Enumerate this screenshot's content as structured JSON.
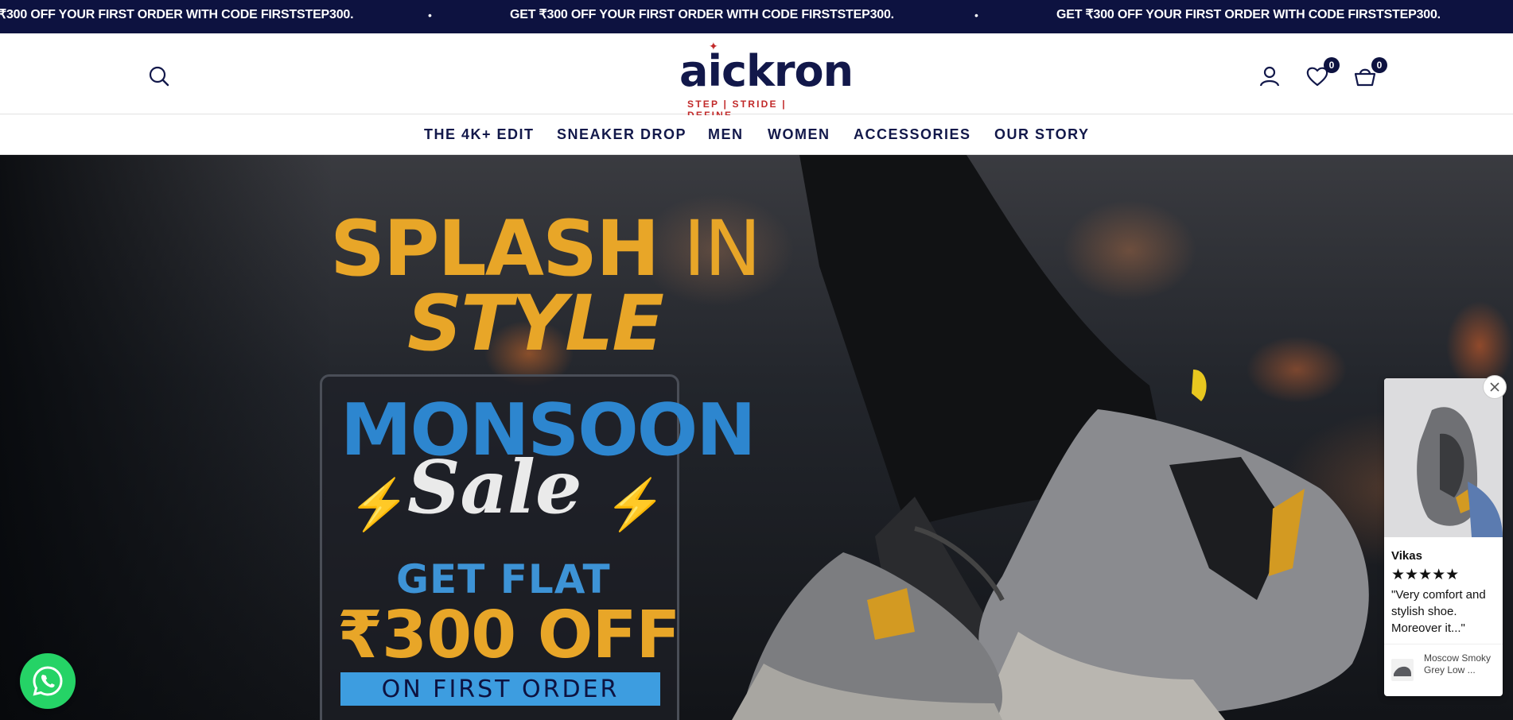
{
  "announcement": {
    "messages": [
      "₹300 OFF YOUR FIRST ORDER WITH CODE FIRSTSTEP300.",
      "GET ₹300 OFF YOUR FIRST ORDER WITH CODE FIRSTSTEP300.",
      "GET ₹300 OFF YOUR FIRST ORDER WITH CODE FIRSTSTEP300."
    ],
    "separator": "•"
  },
  "header": {
    "logo_text": "aickron",
    "logo_tagline": "STEP | STRIDE | DEFINE",
    "logo_star": "✦",
    "wishlist_count": "0",
    "cart_count": "0"
  },
  "nav": {
    "items": [
      {
        "label": "THE 4K+ EDIT"
      },
      {
        "label": "SNEAKER DROP"
      },
      {
        "label": "MEN"
      },
      {
        "label": "WOMEN"
      },
      {
        "label": "ACCESSORIES"
      },
      {
        "label": "OUR STORY"
      }
    ]
  },
  "hero": {
    "headline_1": "SPLASH",
    "headline_2": "IN",
    "headline_3": "STYLE",
    "monsoon": "MONSOON",
    "sale": "Sale",
    "get_flat": "GET FLAT",
    "amount": "₹300 OFF",
    "first_order": "ON FIRST ORDER"
  },
  "review_widget": {
    "name": "Vikas",
    "stars": "★★★★★",
    "rating": 5,
    "quote": "\"Very comfort and stylish shoe. Moreover it...\"",
    "product_name": "Moscow Smoky Grey Low ..."
  },
  "colors": {
    "navy": "#0d1240",
    "accent_gold": "#e8a628",
    "accent_blue": "#2d86cf",
    "whatsapp_green": "#25d366"
  }
}
